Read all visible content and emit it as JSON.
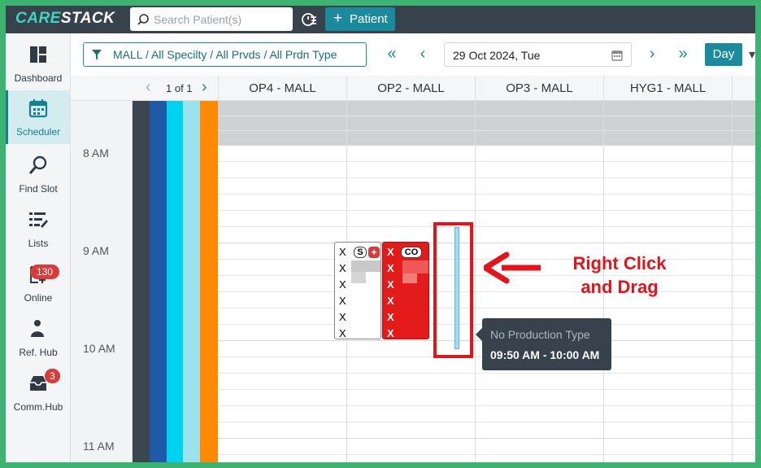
{
  "app": {
    "logo_part1": "CARE",
    "logo_part2": "STACK"
  },
  "search": {
    "placeholder": "Search Patient(s)"
  },
  "patient_button": {
    "label": "Patient"
  },
  "sidebar": {
    "items": [
      {
        "label": "Dashboard",
        "icon": "dashboard-icon"
      },
      {
        "label": "Scheduler",
        "icon": "calendar-icon",
        "active": true
      },
      {
        "label": "Find Slot",
        "icon": "search-icon"
      },
      {
        "label": "Lists",
        "icon": "list-icon"
      },
      {
        "label": "Online",
        "icon": "online-request-icon",
        "badge": "130"
      },
      {
        "label": "Ref. Hub",
        "icon": "referral-icon"
      },
      {
        "label": "Comm.Hub",
        "icon": "inbox-icon",
        "badge": "3"
      }
    ]
  },
  "toolbar": {
    "filter_label": "MALL / All Specilty / All Prvds / All Prdn Type",
    "date": "29 Oct 2024, Tue",
    "view_label": "Day"
  },
  "grid": {
    "pager": "1 of 1",
    "columns": [
      "OP4 - MALL",
      "OP2 - MALL",
      "OP3 - MALL",
      "HYG1 - MALL"
    ],
    "times": [
      "8 AM",
      "9 AM",
      "10 AM",
      "11 AM"
    ]
  },
  "appointments": {
    "white": {
      "marks": [
        "X",
        "X",
        "X",
        "X",
        "X",
        "X"
      ],
      "tag": "S"
    },
    "red": {
      "marks": [
        "X",
        "X",
        "X",
        "X",
        "X",
        "X"
      ],
      "tag": "CO"
    }
  },
  "tooltip": {
    "title": "No Production Type",
    "time": "09:50 AM - 10:00 AM"
  },
  "annotation": {
    "line1": "Right Click",
    "line2": "and Drag"
  },
  "colors": {
    "accent": "#1c8a9c",
    "topbar": "#37424d",
    "annotation": "#e3141b",
    "border": "#3cb371"
  }
}
